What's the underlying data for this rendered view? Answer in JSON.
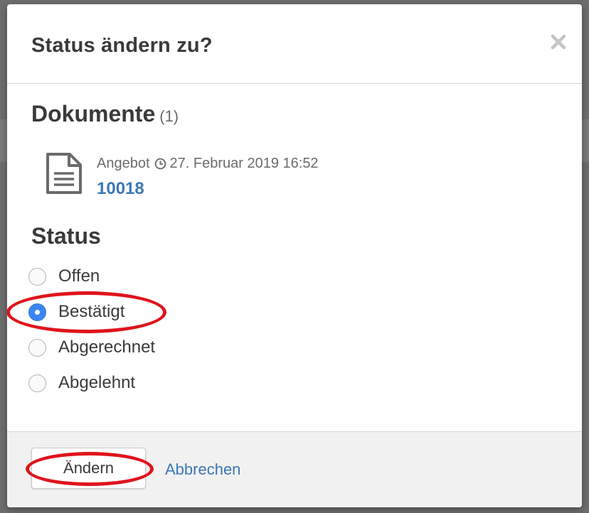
{
  "modal": {
    "title": "Status ändern zu?",
    "close_icon": "close-icon"
  },
  "documents": {
    "heading": "Dokumente",
    "count": "(1)",
    "items": [
      {
        "icon": "document-icon",
        "type": "Angebot",
        "clock_icon": "clock-icon",
        "date": "27. Februar 2019 16:52",
        "number": "10018"
      }
    ]
  },
  "status": {
    "heading": "Status",
    "selected": "Bestätigt",
    "options": [
      {
        "label": "Offen",
        "checked": false
      },
      {
        "label": "Bestätigt",
        "checked": true
      },
      {
        "label": "Abgerechnet",
        "checked": false
      },
      {
        "label": "Abgelehnt",
        "checked": false
      }
    ]
  },
  "footer": {
    "submit_label": "Ändern",
    "cancel_label": "Abbrechen"
  },
  "colors": {
    "link": "#3c78b5",
    "radio_checked": "#3d86f0",
    "annotation": "#e0131b"
  }
}
